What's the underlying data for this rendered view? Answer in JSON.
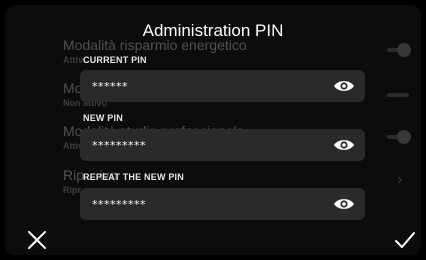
{
  "dialog": {
    "title": "Administration PIN"
  },
  "background_list": [
    {
      "title": "Modalità risparmio energetico",
      "subtitle": "Attiv..."
    },
    {
      "title": "Mo...",
      "subtitle": "Non attivo"
    },
    {
      "title": "Modalità studio professionale",
      "subtitle": "Attiv..."
    },
    {
      "title": "Rip... ivo",
      "subtitle": "Ripr..."
    }
  ],
  "fields": {
    "current_pin": {
      "label": "CURRENT PIN",
      "value": "******"
    },
    "new_pin": {
      "label": "NEW PIN",
      "value": "*********"
    },
    "repeat_pin": {
      "label": "REPEAT THE NEW PIN",
      "value": "*********"
    }
  },
  "icons": {
    "eye": "eye-icon",
    "cancel": "close-icon",
    "confirm": "check-icon"
  },
  "colors": {
    "background": "#0c0c0c",
    "field": "#2a2a2a",
    "text": "#ffffff"
  }
}
